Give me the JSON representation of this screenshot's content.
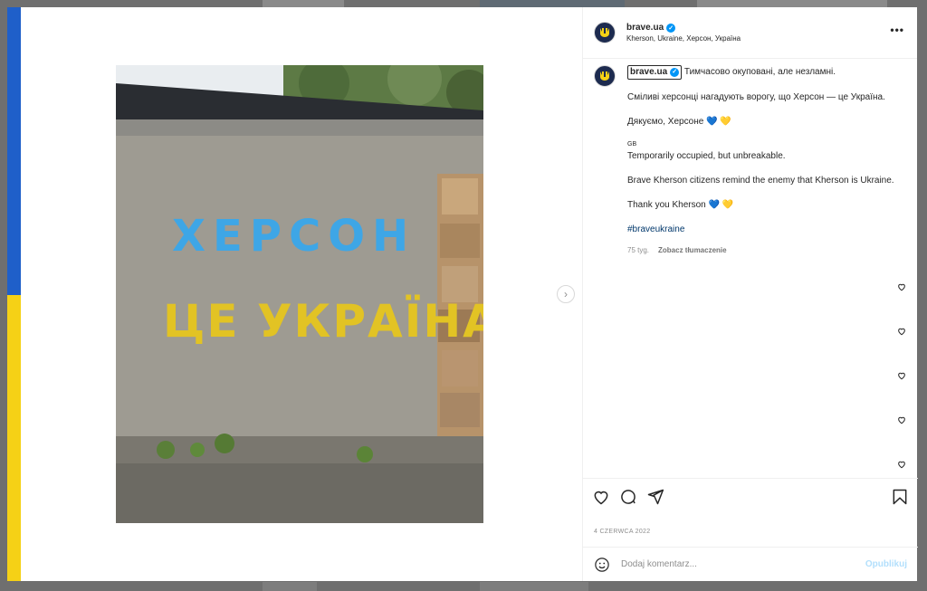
{
  "post": {
    "username": "brave.ua",
    "location": "Kherson, Ukraine, Херсон, Україна",
    "more_label": "•••",
    "caption": {
      "line1": "Тимчасово окуповані, але незламні.",
      "line2": "Сміливі херсонці нагадують ворогу, що Херсон — це Україна.",
      "line3": "Дякуємо, Херсоне 💙 💛",
      "gb_tag": "GB",
      "line4": "Temporarily occupied, but unbreakable.",
      "line5": "Brave Kherson citizens remind the enemy that Kherson is Ukraine.",
      "line6": "Thank you Kherson 💙 💛",
      "hashtag": "#braveukraine",
      "age": "75 tyg.",
      "translate": "Zobacz tłumaczenie"
    },
    "date": "4 CZERWCA 2022",
    "comment_placeholder": "Dodaj komentarz...",
    "publish_label": "Opublikuj"
  },
  "photo_graffiti": {
    "line1": "ХЕРСОН",
    "line2": "ЦЕ УКРАЇНА"
  },
  "colors": {
    "flag_blue": "#1f5fc9",
    "flag_yellow": "#f5d116",
    "verified": "#0095f6",
    "link": "#00376b"
  },
  "icons": [
    "heart-icon",
    "comment-icon",
    "share-icon",
    "bookmark-icon",
    "emoji-icon",
    "chevron-right-icon",
    "verified-icon"
  ]
}
